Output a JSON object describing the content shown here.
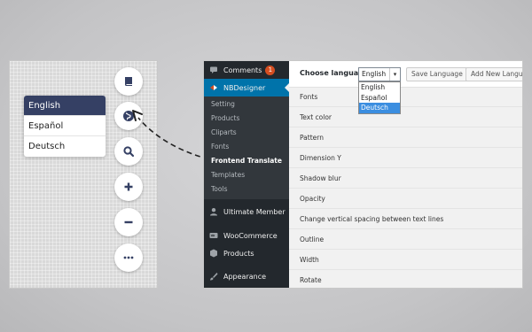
{
  "language_menu": {
    "items": [
      {
        "label": "English",
        "active": true
      },
      {
        "label": "Español",
        "active": false
      },
      {
        "label": "Deutsch",
        "active": false
      }
    ]
  },
  "toolbar_icons": [
    "book-icon",
    "globe-icon",
    "search-icon",
    "plus-icon",
    "minus-icon",
    "more-icon"
  ],
  "admin": {
    "sidebar": {
      "comments": {
        "label": "Comments",
        "badge": "1"
      },
      "nbdesigner": {
        "label": "NBDesigner"
      },
      "submenu": [
        "Setting",
        "Products",
        "Cliparts",
        "Fonts",
        "Frontend Translate",
        "Templates",
        "Tools"
      ],
      "current_submenu": "Frontend Translate",
      "ultimate_member": {
        "label": "Ultimate Member"
      },
      "woocommerce": {
        "label": "WooCommerce"
      },
      "products": {
        "label": "Products"
      },
      "appearance": {
        "label": "Appearance"
      }
    },
    "choose_language": {
      "label": "Choose language",
      "selected": "English",
      "options": [
        "English",
        "Español",
        "Deutsch"
      ],
      "highlighted": "Deutsch",
      "save_button": "Save Language",
      "add_button": "Add New Language"
    },
    "rows": [
      "Fonts",
      "Text color",
      "Pattern",
      "Dimension Y",
      "Shadow blur",
      "Opacity",
      "Change vertical spacing between text lines",
      "Outline",
      "Width",
      "Rotate"
    ]
  },
  "colors": {
    "active_language": "#354064",
    "wp_sidebar": "#23282d",
    "wp_current": "#0073aa",
    "dropdown_highlight": "#3b8ee0"
  }
}
